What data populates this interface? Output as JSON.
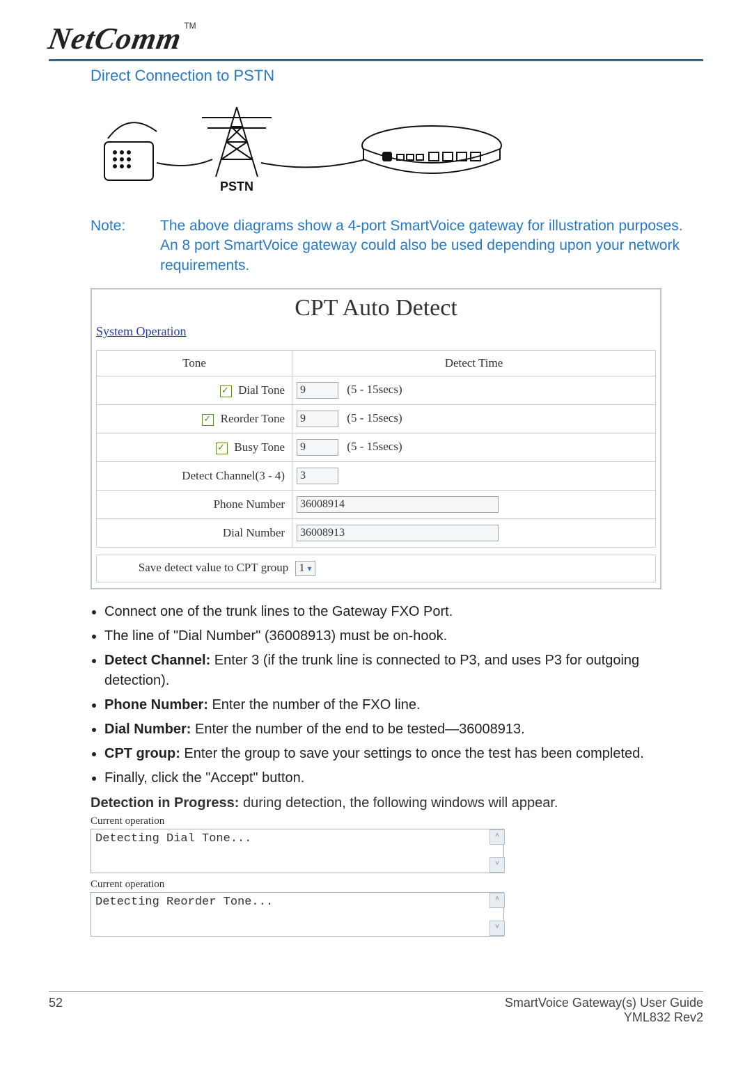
{
  "header": {
    "logo_text": "NetComm",
    "tm": "TM"
  },
  "section_title": "Direct Connection to PSTN",
  "diagram_label": "PSTN",
  "note": {
    "label": "Note:",
    "text": "The above diagrams show a 4-port SmartVoice gateway for illustration purposes. An 8 port SmartVoice gateway could also be used depending upon your network requirements."
  },
  "cpt": {
    "title": "CPT Auto Detect",
    "system_link": "System Operation",
    "headers": {
      "tone": "Tone",
      "detect_time": "Detect Time"
    },
    "rows": {
      "dial_tone": {
        "label": "Dial Tone",
        "value": "9",
        "hint": "(5 - 15secs)"
      },
      "reorder_tone": {
        "label": "Reorder Tone",
        "value": "9",
        "hint": "(5 - 15secs)"
      },
      "busy_tone": {
        "label": "Busy Tone",
        "value": "9",
        "hint": "(5 - 15secs)"
      },
      "detect_channel": {
        "label": "Detect Channel(3 - 4)",
        "value": "3"
      },
      "phone_number": {
        "label": "Phone Number",
        "value": "36008914"
      },
      "dial_number": {
        "label": "Dial Number",
        "value": "36008913"
      }
    },
    "save_label": "Save detect value to CPT group",
    "save_value": "1"
  },
  "instructions": {
    "i1": "Connect one of the trunk lines to the Gateway FXO Port.",
    "i2": "The line of \"Dial Number\" (36008913) must be on-hook.",
    "i3_bold": "Detect Channel:",
    "i3_rest": " Enter 3 (if the trunk line is connected to P3, and uses P3 for outgoing detection).",
    "i4_bold": "Phone Number:",
    "i4_rest": " Enter the number of the FXO line.",
    "i5_bold": "Dial Number:",
    "i5_rest": " Enter the number of the end to be tested—36008913.",
    "i6_bold": "CPT group:",
    "i6_rest": " Enter the group to save your settings to once the test has been completed.",
    "i7": "Finally, click the \"Accept\" button."
  },
  "detection": {
    "heading_bold": "Detection in Progress:",
    "heading_rest": " during detection, the following windows will appear.",
    "op_label": "Current operation",
    "box1": "Detecting Dial Tone...",
    "box2": "Detecting Reorder Tone..."
  },
  "footer": {
    "page": "52",
    "guide": "SmartVoice Gateway(s) User Guide",
    "rev": "YML832 Rev2"
  }
}
